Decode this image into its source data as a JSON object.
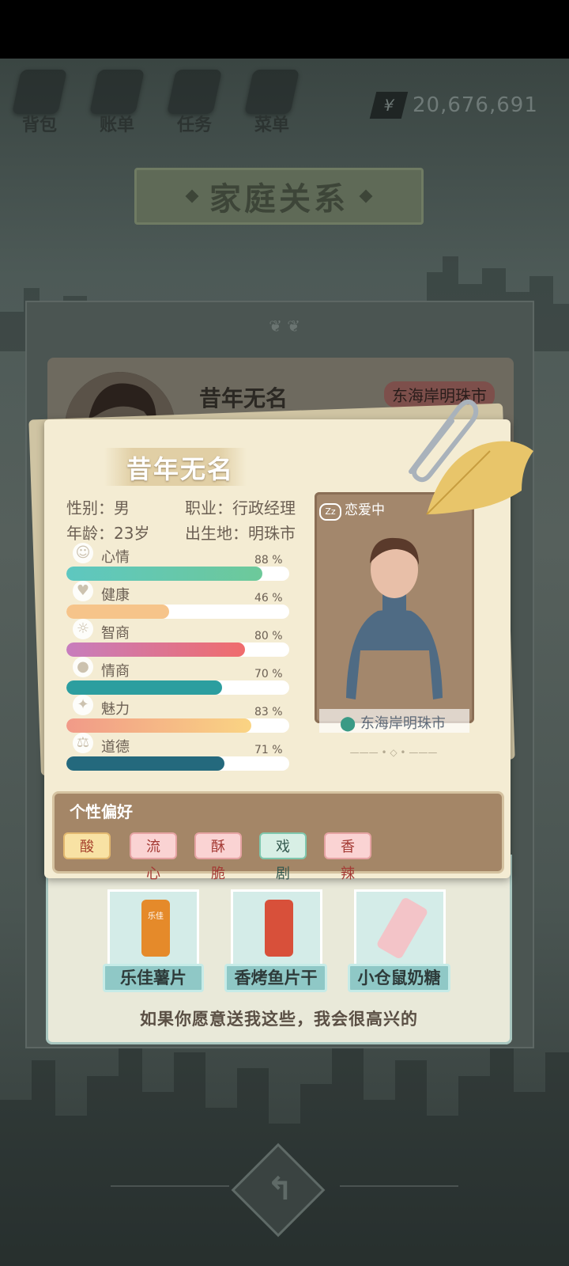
{
  "nav": {
    "bag": "背包",
    "ledger": "账单",
    "tasks": "任务",
    "menu": "菜单"
  },
  "currency": {
    "symbol": "¥",
    "amount": "20,676,691"
  },
  "page_title": "家庭关系",
  "back_card": {
    "name": "昔年无名",
    "location": "东海岸明珠市"
  },
  "profile": {
    "name": "昔年无名",
    "gender_label": "性别：男",
    "job_label": "职业：行政经理",
    "age_label": "年龄：23岁",
    "birthplace_label": "出生地：明珠市",
    "status": "恋爱中",
    "location": "东海岸明珠市"
  },
  "stats": [
    {
      "label": "心情",
      "pct_text": "88 %",
      "value": 88,
      "icon": "smile-icon",
      "color_from": "#5ec7c0",
      "color_to": "#6dc99a"
    },
    {
      "label": "健康",
      "pct_text": "46 %",
      "value": 46,
      "icon": "heart-icon",
      "color_from": "#f6c48a",
      "color_to": "#f6c48a"
    },
    {
      "label": "智商",
      "pct_text": "80 %",
      "value": 80,
      "icon": "lightbulb-icon",
      "color_from": "#c77dbd",
      "color_to": "#f06c6c"
    },
    {
      "label": "情商",
      "pct_text": "70 %",
      "value": 70,
      "icon": "apple-icon",
      "color_from": "#2c9e9f",
      "color_to": "#2c9e9f"
    },
    {
      "label": "魅力",
      "pct_text": "83 %",
      "value": 83,
      "icon": "sparkle-icon",
      "color_from": "#f19a88",
      "color_to": "#fad483"
    },
    {
      "label": "道德",
      "pct_text": "71 %",
      "value": 71,
      "icon": "scales-icon",
      "color_from": "#24697d",
      "color_to": "#24697d"
    }
  ],
  "preferences": {
    "title": "个性偏好",
    "tags": [
      {
        "label": "酸",
        "bg": "#f8e2a4",
        "fg": "#a5402d",
        "border": "#e2b86f"
      },
      {
        "label": "流心",
        "bg": "#fad3d3",
        "fg": "#a43a34",
        "border": "#e6a3a3"
      },
      {
        "label": "酥脆",
        "bg": "#fad3d3",
        "fg": "#a43a34",
        "border": "#e6a3a3"
      },
      {
        "label": "戏剧",
        "bg": "#d8efe5",
        "fg": "#34584e",
        "border": "#7fc7ad"
      },
      {
        "label": "香辣",
        "bg": "#fad3d3",
        "fg": "#a43a34",
        "border": "#e6a3a3"
      }
    ]
  },
  "gifts": [
    {
      "name": "乐佳薯片",
      "count": "1",
      "icon": "chips-can-icon",
      "brand": "乐佳"
    },
    {
      "name": "香烤鱼片干",
      "count": "1",
      "icon": "fish-snack-icon"
    },
    {
      "name": "小仓鼠奶糖",
      "count": "1",
      "icon": "hamster-candy-icon"
    }
  ],
  "gift_message": "如果你愿意送我这些，我会很高兴的"
}
